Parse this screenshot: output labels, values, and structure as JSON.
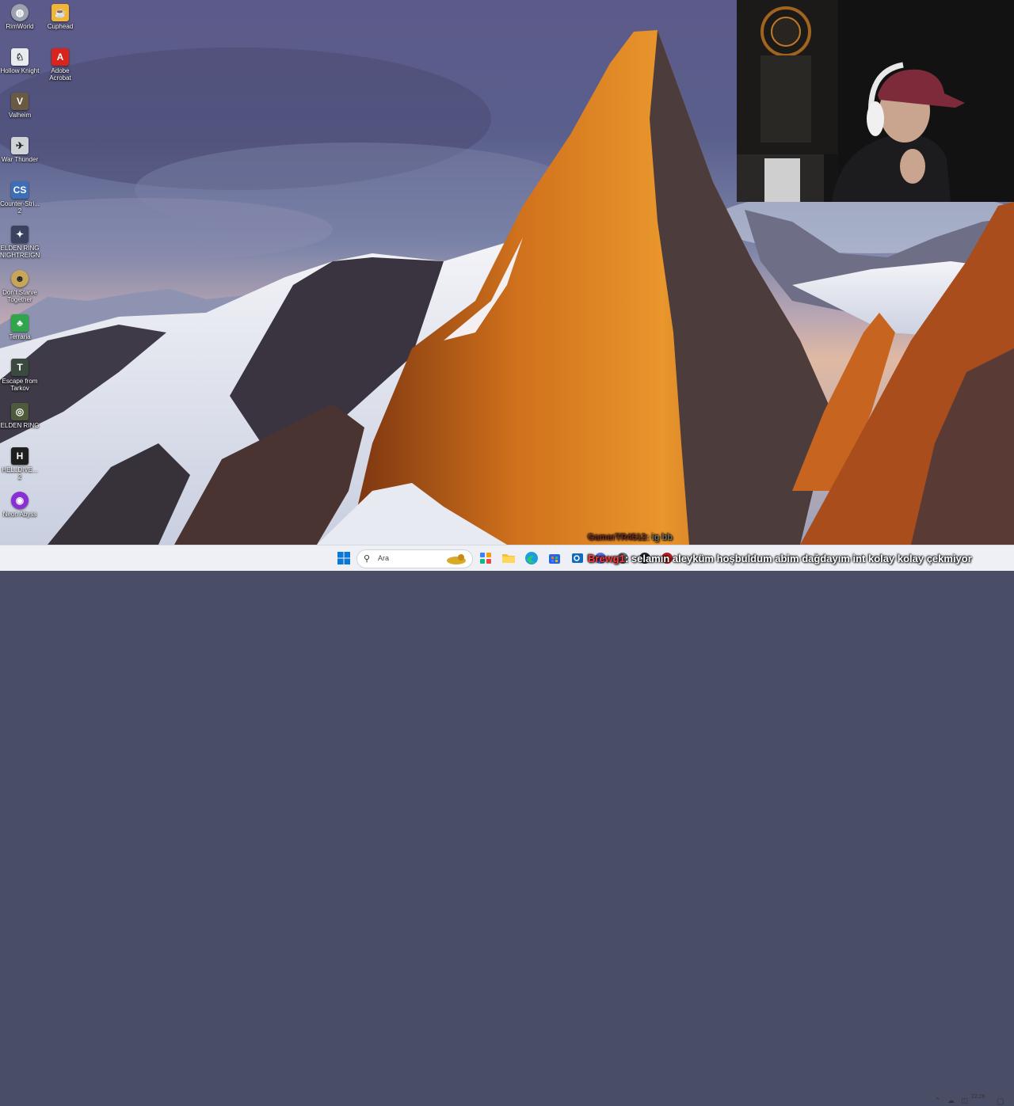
{
  "desktop": {
    "icons": [
      {
        "label": "RimWorld",
        "icon": "rimworld-icon",
        "color": "#9aa2b0"
      },
      {
        "label": "Cuphead",
        "icon": "cuphead-icon",
        "color": "#f2b634"
      },
      {
        "label": "Hollow Knight",
        "icon": "hollow-knight-icon",
        "color": "#e9ecef"
      },
      {
        "label": "Adobe Acrobat",
        "icon": "adobe-acrobat-icon",
        "color": "#d9231d"
      },
      {
        "label": "Valheim",
        "icon": "valheim-icon",
        "color": "#6b5a43"
      },
      {
        "label": "War Thunder",
        "icon": "war-thunder-icon",
        "color": "#cfd3d8"
      },
      {
        "label": "Counter-Stri... 2",
        "icon": "counter-strike-icon",
        "color": "#3c6fb8"
      },
      {
        "label": "ELDEN RING NIGHTREIGN",
        "icon": "elden-ring-nightreign-icon",
        "color": "#3a4260"
      },
      {
        "label": "Don't Starve Together",
        "icon": "dont-starve-icon",
        "color": "#c7a55a"
      },
      {
        "label": "Terraria",
        "icon": "terraria-icon",
        "color": "#2fa64a"
      },
      {
        "label": "Escape from Tarkov",
        "icon": "tarkov-icon",
        "color": "#3b4a3f"
      },
      {
        "label": "ELDEN RING",
        "icon": "elden-ring-icon",
        "color": "#4e5a3c"
      },
      {
        "label": "HELLDIVE... 2",
        "icon": "helldivers-icon",
        "color": "#1f1f1f"
      },
      {
        "label": "Neon Abyss",
        "icon": "neon-abyss-icon",
        "color": "#8a2fd6"
      }
    ]
  },
  "taskbar": {
    "search_placeholder": "Ara",
    "apps": [
      "start-icon",
      "search-icon",
      "widgets-icon",
      "file-explorer-icon",
      "edge-icon",
      "store-icon",
      "outlook-icon"
    ],
    "clock": "22:26"
  },
  "chat": {
    "faded": {
      "user": "GamerTR4512",
      "message": ": ig bb"
    },
    "main": {
      "user": "Brewg1",
      "message": ": selamın aleyküm hoşbuldum abim dağdayım int kolay kolay çekmiyor"
    }
  },
  "colors": {
    "taskbar_bg": "#eef0f6",
    "chat_user": "#ff3b3b",
    "accent": "#0067c0"
  }
}
